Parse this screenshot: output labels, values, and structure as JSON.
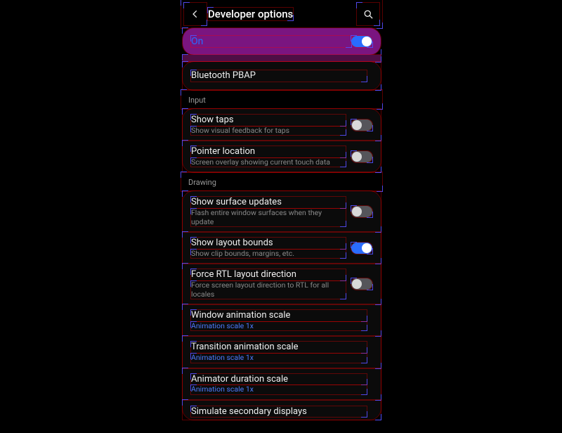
{
  "header": {
    "title": "Developer options"
  },
  "master": {
    "label": "On",
    "state": "on"
  },
  "stray_row": {
    "title": "Bluetooth PBAP"
  },
  "sections": [
    {
      "header": "Input",
      "items": [
        {
          "title": "Show taps",
          "sub": "Show visual feedback for taps",
          "switch": "off"
        },
        {
          "title": "Pointer location",
          "sub": "Screen overlay showing current touch data",
          "switch": "off"
        }
      ]
    },
    {
      "header": "Drawing",
      "items": [
        {
          "title": "Show surface updates",
          "sub": "Flash entire window surfaces when they update",
          "switch": "off"
        },
        {
          "title": "Show layout bounds",
          "sub": "Show clip bounds, margins, etc.",
          "switch": "on"
        },
        {
          "title": "Force RTL layout direction",
          "sub": "Force screen layout direction to RTL for all locales",
          "switch": "off"
        },
        {
          "title": "Window animation scale",
          "sub": "Animation scale 1x",
          "accent": true
        },
        {
          "title": "Transition animation scale",
          "sub": "Animation scale 1x",
          "accent": true
        },
        {
          "title": "Animator duration scale",
          "sub": "Animation scale 1x",
          "accent": true
        },
        {
          "title": "Simulate secondary displays"
        }
      ]
    }
  ]
}
